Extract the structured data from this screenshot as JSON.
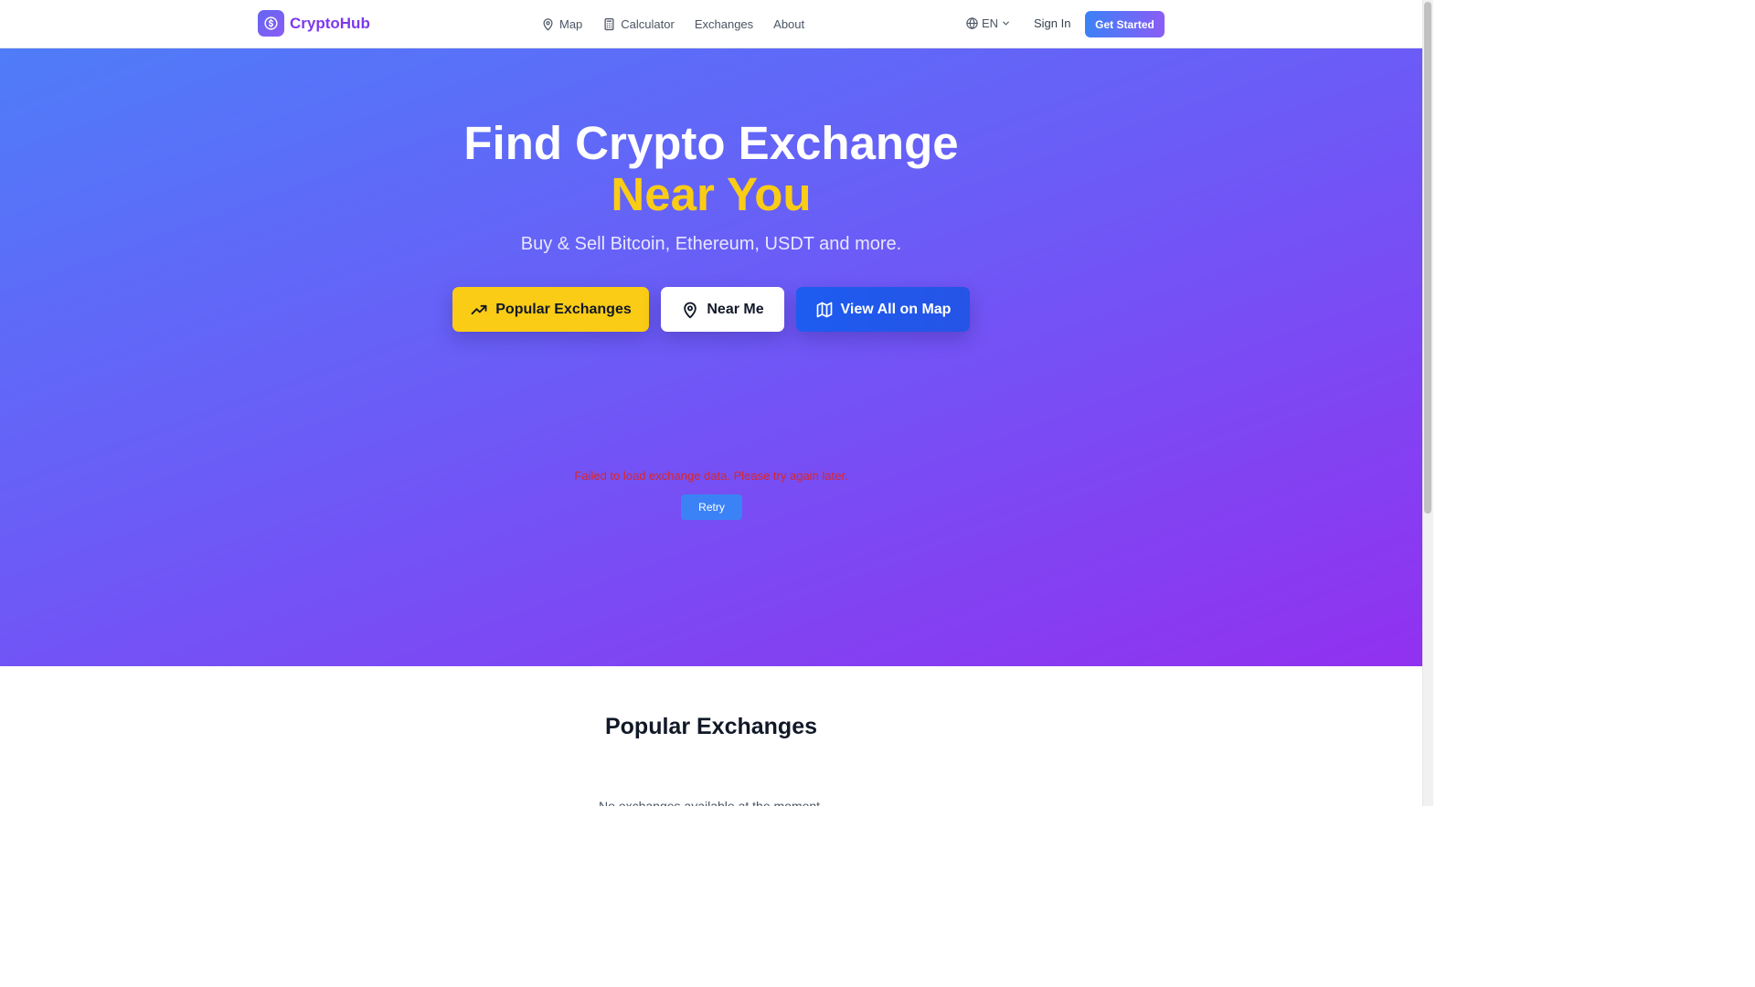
{
  "header": {
    "brand": "CryptoHub",
    "nav": [
      {
        "label": "Map",
        "icon": "map-pin-icon"
      },
      {
        "label": "Calculator",
        "icon": "calculator-icon"
      },
      {
        "label": "Exchanges"
      },
      {
        "label": "About"
      }
    ],
    "language": "EN",
    "sign_in": "Sign In",
    "get_started": "Get Started"
  },
  "hero": {
    "title_line1": "Find Crypto Exchange",
    "title_line2": "Near You",
    "subtitle": "Buy & Sell Bitcoin, Ethereum, USDT and more.",
    "buttons": {
      "popular": "Popular Exchanges",
      "near_me": "Near Me",
      "view_map": "View All on Map"
    },
    "error_message": "Failed to load exchange data. Please try again later.",
    "retry": "Retry"
  },
  "popular_section": {
    "title": "Popular Exchanges",
    "empty_message": "No exchanges available at the moment."
  },
  "colors": {
    "brand": "#7c3aed",
    "accent_yellow": "#facc15",
    "primary_blue": "#1d4ed8",
    "error": "#dc2626"
  }
}
